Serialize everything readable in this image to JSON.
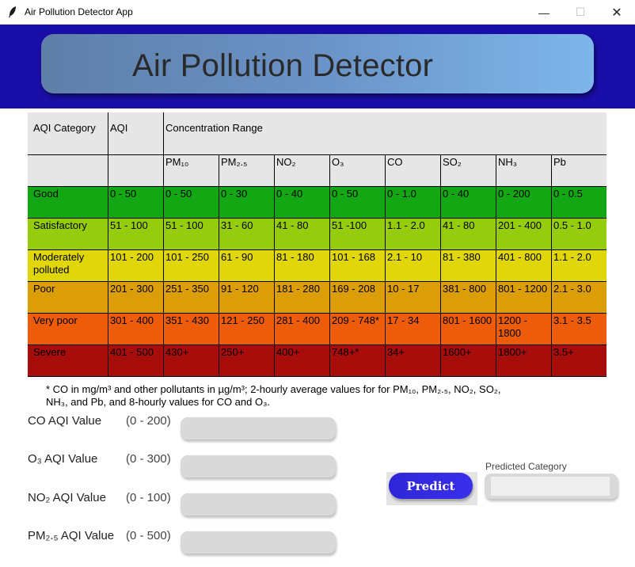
{
  "window": {
    "title": "Air Pollution Detector App",
    "minimize": "—",
    "maximize": "☐",
    "close": "✕"
  },
  "header": {
    "title": "Air Pollution Detector",
    "background": "#1a0ea8"
  },
  "table": {
    "headers": {
      "category": "AQI Category",
      "aqi": "AQI",
      "range": "Concentration Range"
    },
    "pollutants": [
      "PM₁₀",
      "PM₂.₅",
      "NO₂",
      "O₃",
      "CO",
      "SO₂",
      "NH₃",
      "Pb"
    ],
    "rows": [
      {
        "category": "Good",
        "aqi": "0 - 50",
        "values": [
          "0 - 50",
          "0 - 30",
          "0 - 40",
          "0 - 50",
          "0 - 1.0",
          "0 - 40",
          "0 - 200",
          "0 - 0.5"
        ],
        "color": "#13a713"
      },
      {
        "category": "Satisfactory",
        "aqi": "51 - 100",
        "values": [
          "51 - 100",
          "31 - 60",
          "41 - 80",
          "51 -100",
          "1.1 - 2.0",
          "41 - 80",
          "201 - 400",
          "0.5 - 1.0"
        ],
        "color": "#96cc0e"
      },
      {
        "category": "Moderately polluted",
        "aqi": "101 - 200",
        "values": [
          "101 - 250",
          "61 - 90",
          "81 - 180",
          "101 - 168",
          "2.1 - 10",
          "81 - 380",
          "401 - 800",
          "1.1 - 2.0"
        ],
        "color": "#e0d60a"
      },
      {
        "category": "Poor",
        "aqi": "201 - 300",
        "values": [
          "251 - 350",
          "91 - 120",
          "181 - 280",
          "169 - 208",
          "10 - 17",
          "381 - 800",
          "801 - 1200",
          "2.1 - 3.0"
        ],
        "color": "#dc9e08"
      },
      {
        "category": "Very poor",
        "aqi": "301 - 400",
        "values": [
          "351 - 430",
          "121 - 250",
          "281 - 400",
          "209 - 748*",
          "17 - 34",
          "801 - 1600",
          "1200 - 1800",
          "3.1 - 3.5"
        ],
        "color": "#ec5c0a"
      },
      {
        "category": "Severe",
        "aqi": "401 - 500",
        "values": [
          "430+",
          "250+",
          "400+",
          "748+*",
          "34+",
          "1600+",
          "1800+",
          "3.5+"
        ],
        "color": "#a70d0b"
      }
    ],
    "header_bg": "#e6e6e6"
  },
  "footnote": {
    "line1": "* CO in mg/m³ and other pollutants in µg/m³; 2-hourly average values for for PM₁₀, PM₂.₅, NO₂, SO₂,",
    "line2": "NH₃, and Pb, and 8-hourly values for CO and O₃."
  },
  "inputs": [
    {
      "label": "CO AQI Value",
      "range": "(0 - 200)",
      "value": ""
    },
    {
      "label": "O₃ AQI Value",
      "range": "(0 - 300)",
      "value": ""
    },
    {
      "label": "NO₂ AQI Value",
      "range": "(0 - 100)",
      "value": ""
    },
    {
      "label": "PM₂.₅ AQI Value",
      "range": "(0 - 500)",
      "value": ""
    }
  ],
  "predict": {
    "label": "Predict",
    "color": "#2f26d8"
  },
  "prediction": {
    "label": "Predicted Category",
    "value": ""
  },
  "icons": {
    "app": "feather-icon"
  }
}
